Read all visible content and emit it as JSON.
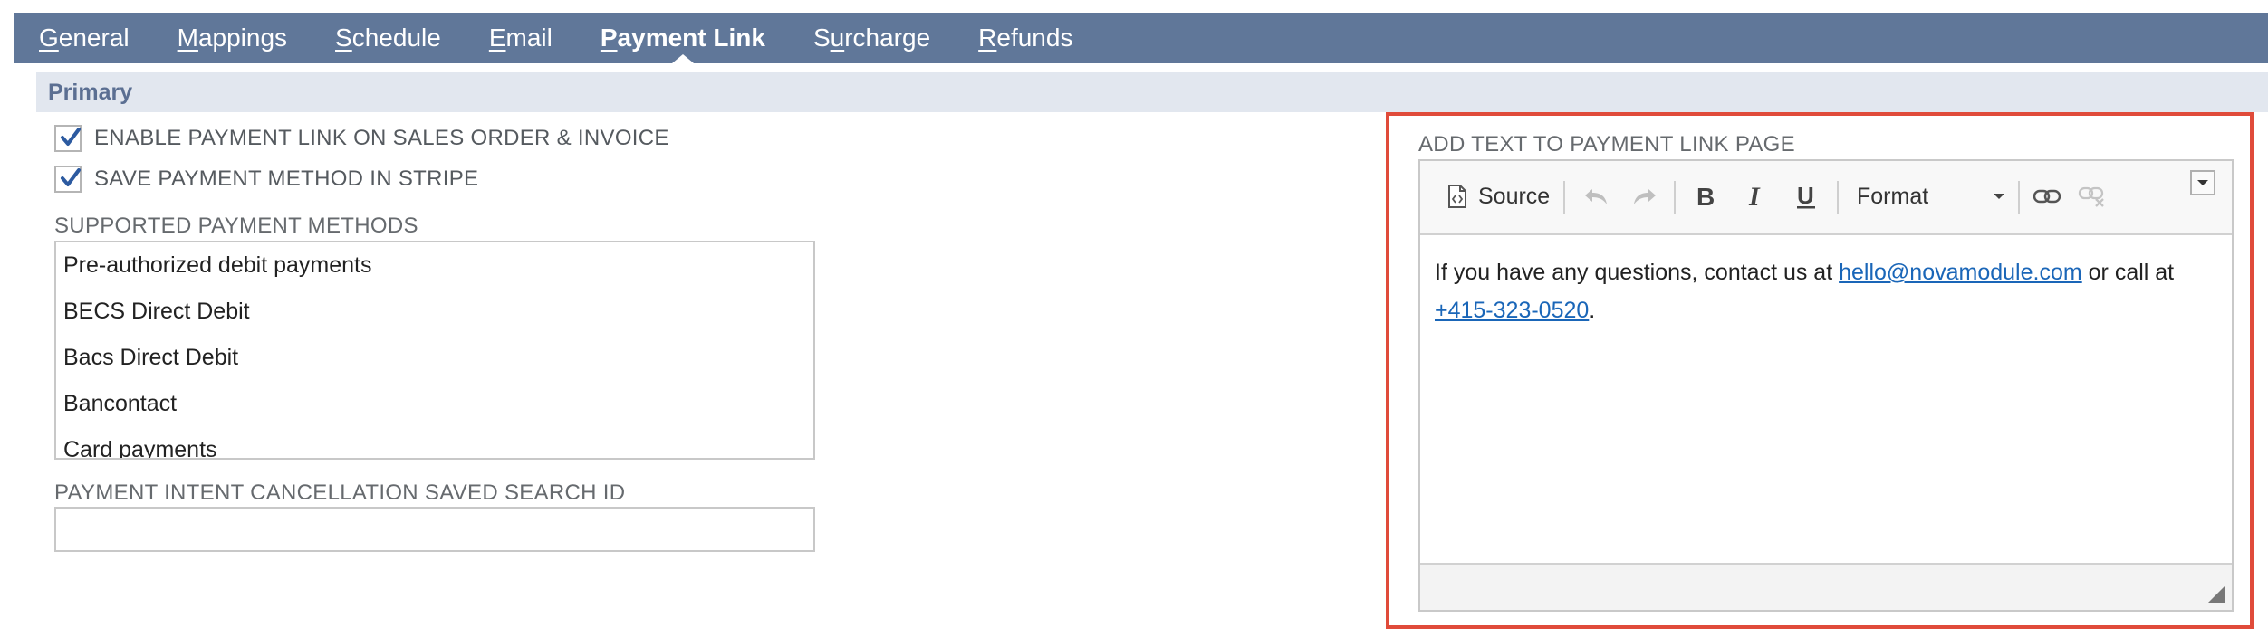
{
  "tabs": [
    {
      "label": "eneral",
      "accel": "G"
    },
    {
      "label": "appings",
      "accel": "M"
    },
    {
      "label": "chedule",
      "accel": "S"
    },
    {
      "label": "mail",
      "accel": "E"
    },
    {
      "label": "ayment Link",
      "accel": "P"
    },
    {
      "label": "rcharge",
      "accel": "u",
      "prefix": "S"
    },
    {
      "label": "efunds",
      "accel": "R"
    }
  ],
  "section": {
    "title": "Primary"
  },
  "checkboxes": {
    "enable_payment_link": {
      "label": "ENABLE PAYMENT LINK ON SALES ORDER & INVOICE",
      "checked": true
    },
    "save_payment_method": {
      "label": "SAVE PAYMENT METHOD IN STRIPE",
      "checked": true
    }
  },
  "supported_methods": {
    "label": "SUPPORTED PAYMENT METHODS",
    "items": [
      "Pre-authorized debit payments",
      "BECS Direct Debit",
      "Bacs Direct Debit",
      "Bancontact",
      "Card payments"
    ]
  },
  "cancellation_search": {
    "label": "PAYMENT INTENT CANCELLATION SAVED SEARCH ID",
    "value": ""
  },
  "editor": {
    "label": "ADD TEXT TO PAYMENT LINK PAGE",
    "toolbar": {
      "source_label": "Source",
      "format_label": "Format",
      "icons": [
        "source-icon",
        "undo-icon",
        "redo-icon",
        "bold-icon",
        "italic-icon",
        "underline-icon",
        "link-icon",
        "unlink-icon",
        "toolbar-collapse-icon"
      ]
    },
    "content": {
      "text_before": "If you have any questions, contact us at ",
      "email": "hello@novamodule.com",
      "text_middle": " or call at ",
      "phone": "+415-323-0520",
      "text_after": "."
    }
  },
  "colors": {
    "tabbar": "#607799",
    "section_header_bg": "#e2e7ef",
    "highlight": "#e04b3a",
    "link": "#1a66b8"
  }
}
